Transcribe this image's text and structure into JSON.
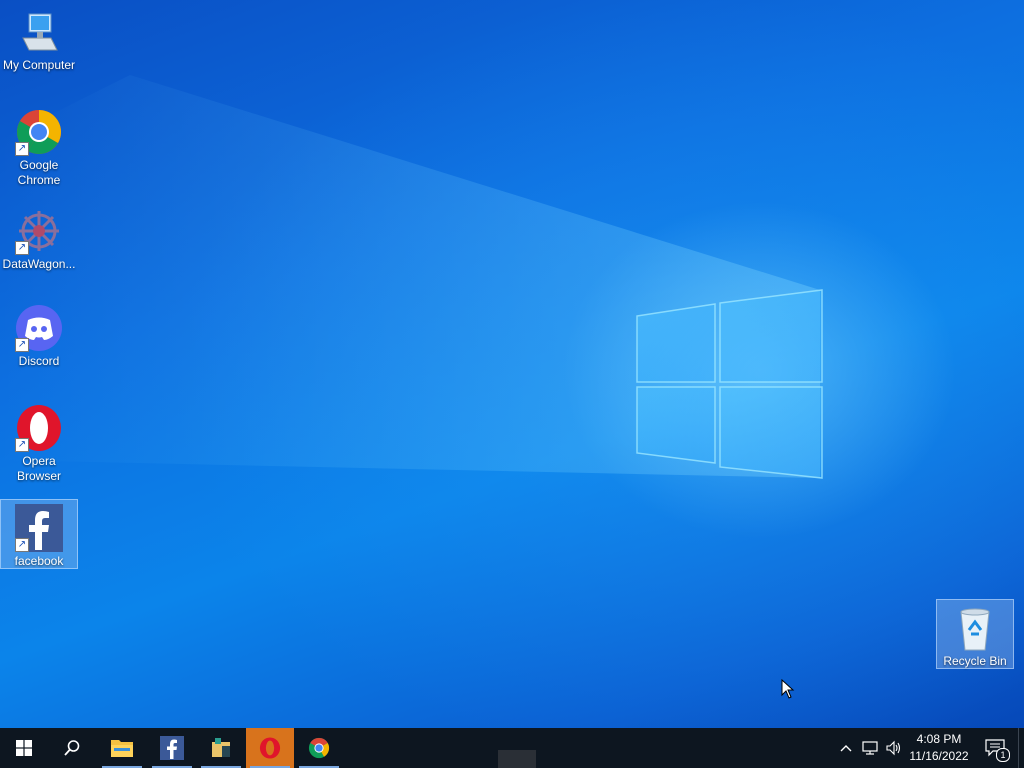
{
  "desktop_icons": [
    {
      "label": "My Computer"
    },
    {
      "label": "Google Chrome"
    },
    {
      "label": "DataWagon..."
    },
    {
      "label": "Discord"
    },
    {
      "label": "Opera Browser"
    },
    {
      "label": "facebook"
    }
  ],
  "recycle_bin": {
    "label": "Recycle Bin"
  },
  "taskbar": {
    "apps": [
      "start-icon",
      "search-icon",
      "file-explorer-icon",
      "facebook-icon",
      "app-icon",
      "opera-icon",
      "chrome-icon"
    ],
    "clock": {
      "time": "4:08 PM",
      "date": "11/16/2022"
    },
    "notification_count": "1"
  },
  "colors": {
    "accent": "#0a63d6",
    "taskbar": "#0d1620",
    "opera_highlight": "#d8731c"
  }
}
